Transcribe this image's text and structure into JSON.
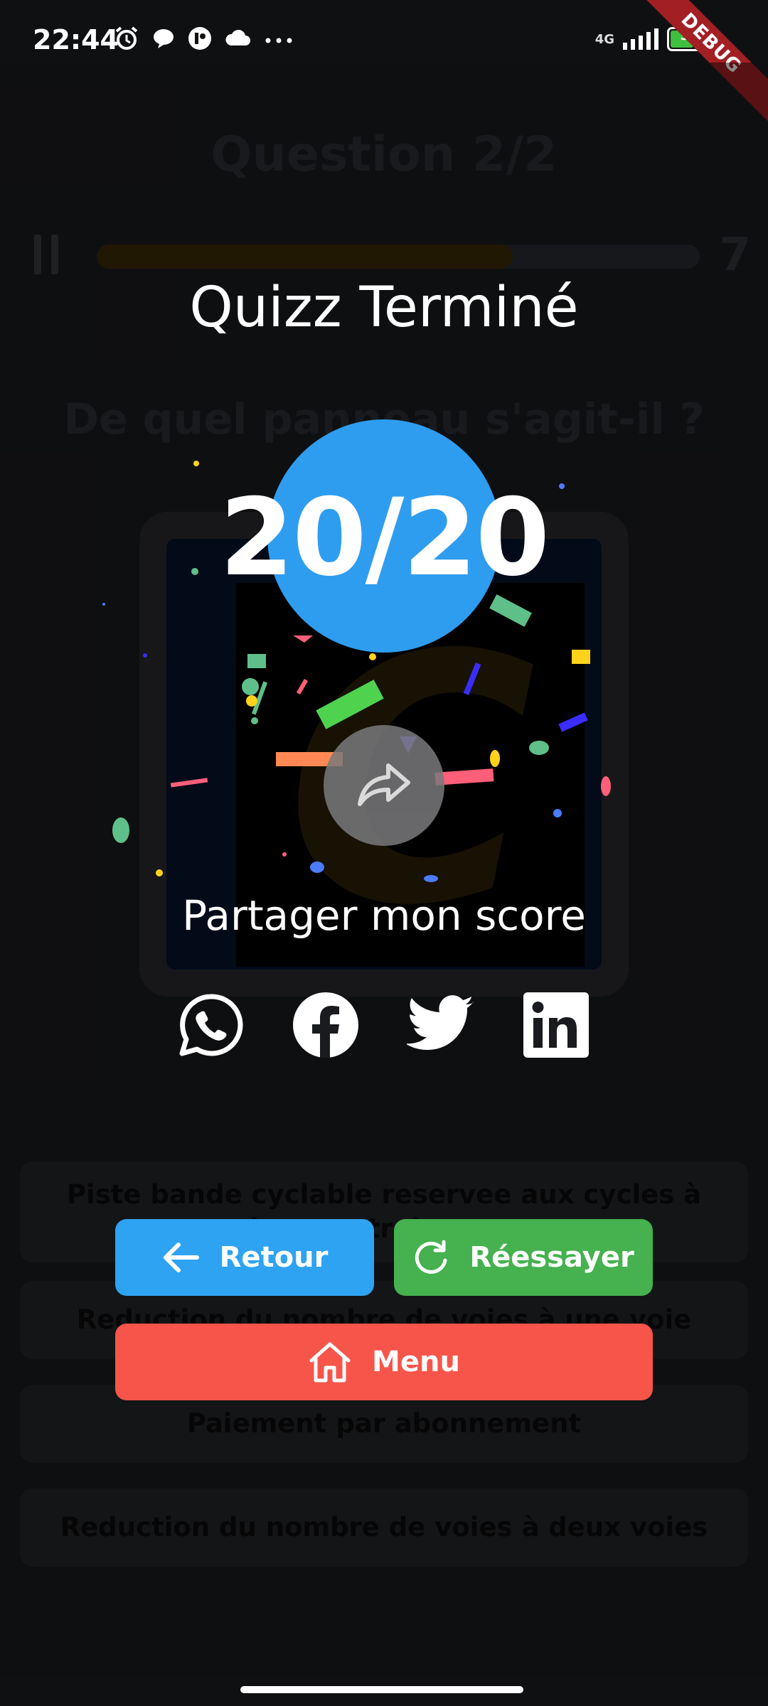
{
  "status_bar": {
    "time": "22:44",
    "network": "4G",
    "battery": "55",
    "debug_label": "DEBUG"
  },
  "background_quiz": {
    "question_counter": "Question 2/2",
    "timer_value": "7",
    "progress_fraction": 0.69,
    "question_text": "De quel panneau s'agit-il ?",
    "sign_glyph": "C",
    "answers": [
      "Piste bande cyclable reservee aux cycles à deux ou trois roues",
      "Reduction du nombre de voies à une voie",
      "Paiement par abonnement",
      "Reduction du nombre de voies à deux voies"
    ]
  },
  "result": {
    "title": "Quizz Terminé",
    "score": "20/20",
    "share_label": "Partager mon score",
    "socials": [
      "whatsapp-icon",
      "facebook-icon",
      "twitter-icon",
      "linkedin-icon"
    ]
  },
  "actions": {
    "back_label": "Retour",
    "retry_label": "Réessayer",
    "menu_label": "Menu"
  },
  "colors": {
    "accent_blue": "#2e9df0",
    "retry_green": "#45b14f",
    "menu_red": "#f7554a",
    "background": "#1b1c20"
  }
}
